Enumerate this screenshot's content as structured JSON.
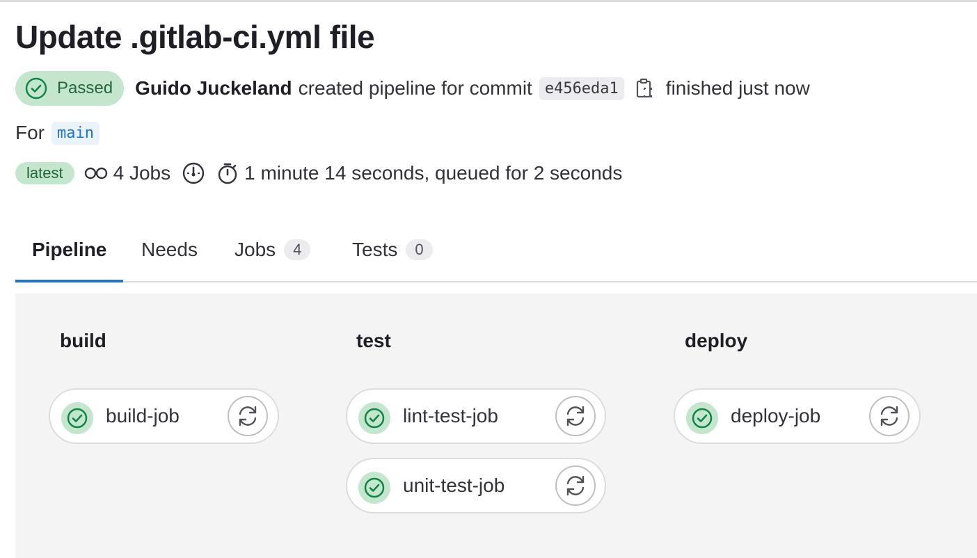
{
  "header": {
    "title": "Update .gitlab-ci.yml file",
    "status_label": "Passed",
    "author": "Guido Juckeland",
    "action_text": "created pipeline for commit",
    "commit_sha": "e456eda1",
    "finished_text": "finished just now",
    "for_label": "For",
    "branch": "main",
    "latest_badge": "latest",
    "jobs_count_text": "4 Jobs",
    "duration_text": "1 minute 14 seconds, queued for 2 seconds"
  },
  "tabs": [
    {
      "label": "Pipeline",
      "active": true
    },
    {
      "label": "Needs"
    },
    {
      "label": "Jobs",
      "count": "4"
    },
    {
      "label": "Tests",
      "count": "0"
    }
  ],
  "stages": [
    {
      "name": "build",
      "jobs": [
        {
          "name": "build-job",
          "status": "passed"
        }
      ]
    },
    {
      "name": "test",
      "jobs": [
        {
          "name": "lint-test-job",
          "status": "passed"
        },
        {
          "name": "unit-test-job",
          "status": "passed"
        }
      ]
    },
    {
      "name": "deploy",
      "jobs": [
        {
          "name": "deploy-job",
          "status": "passed"
        }
      ]
    }
  ],
  "icons": {
    "status": "check-circle-icon",
    "copy": "clipboard-icon",
    "jobs": "pipeline-jobs-icon",
    "speedometer": "gauge-icon",
    "timer": "stopwatch-icon",
    "retry": "retry-icon"
  },
  "colors": {
    "success_bg": "#c3e6cd",
    "success_fg": "#24663b",
    "link": "#1f75cb",
    "tab_active_underline": "#1f75cb"
  }
}
